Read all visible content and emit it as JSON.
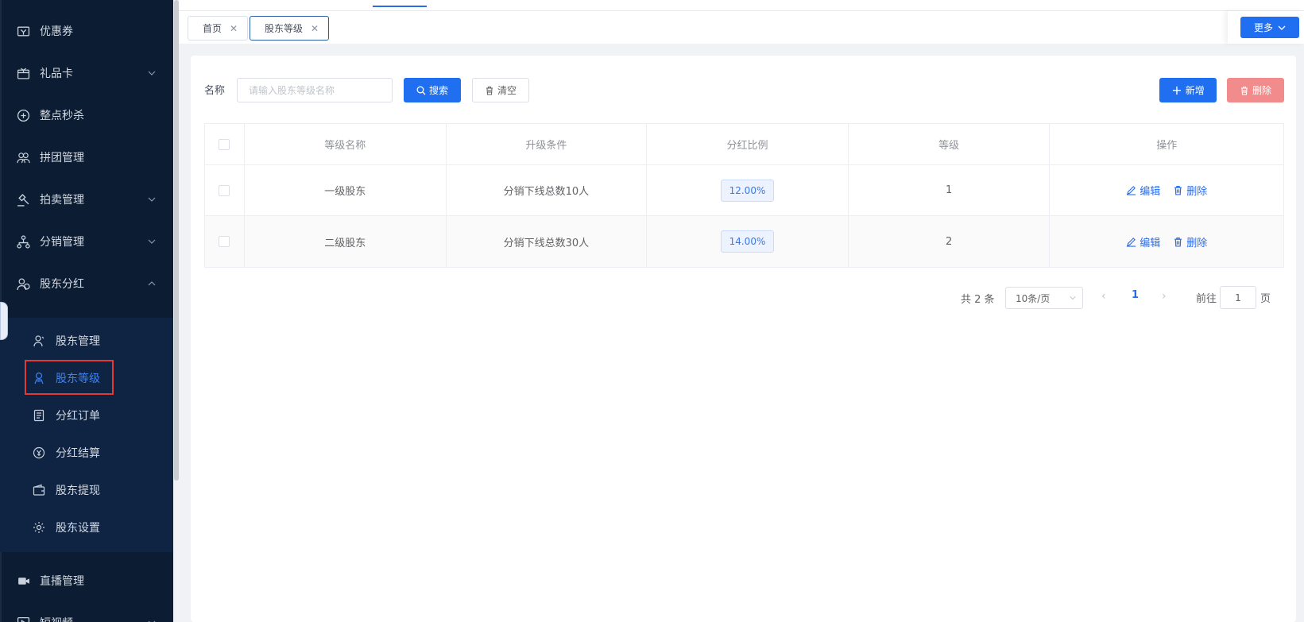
{
  "sidebar": {
    "items": [
      {
        "label": "优惠券",
        "icon": "coupon-icon"
      },
      {
        "label": "礼品卡",
        "icon": "gift-card-icon"
      },
      {
        "label": "整点秒杀",
        "icon": "flash-sale-icon"
      },
      {
        "label": "拼团管理",
        "icon": "group-buy-icon"
      },
      {
        "label": "拍卖管理",
        "icon": "auction-icon"
      },
      {
        "label": "分销管理",
        "icon": "distribution-icon"
      },
      {
        "label": "股东分红",
        "icon": "shareholder-dividend-icon"
      }
    ],
    "sub_items": [
      {
        "label": "股东管理",
        "icon": "user-icon"
      },
      {
        "label": "股东等级",
        "icon": "level-icon"
      },
      {
        "label": "分红订单",
        "icon": "order-icon"
      },
      {
        "label": "分红结算",
        "icon": "settlement-icon"
      },
      {
        "label": "股东提现",
        "icon": "wallet-icon"
      },
      {
        "label": "股东设置",
        "icon": "gear-icon"
      }
    ],
    "bottom_items": [
      {
        "label": "直播管理",
        "icon": "video-icon"
      },
      {
        "label": "短视频",
        "icon": "play-icon"
      }
    ]
  },
  "tabs": [
    {
      "label": "首页"
    },
    {
      "label": "股东等级"
    }
  ],
  "more_button": "更多",
  "filter": {
    "name_label": "名称",
    "placeholder": "请输入股东等级名称",
    "search_label": "搜索",
    "clear_label": "清空"
  },
  "actions": {
    "add_label": "新增",
    "delete_label": "删除"
  },
  "table": {
    "headers": [
      "等级名称",
      "升级条件",
      "分红比例",
      "等级",
      "操作"
    ],
    "rows": [
      {
        "name": "一级股东",
        "condition": "分销下线总数10人",
        "ratio": "12.00%",
        "level": "1"
      },
      {
        "name": "二级股东",
        "condition": "分销下线总数30人",
        "ratio": "14.00%",
        "level": "2"
      }
    ],
    "edit_label": "编辑",
    "row_delete_label": "删除"
  },
  "pagination": {
    "total": "共 2 条",
    "page_size": "10条/页",
    "current_page": "1",
    "goto_label": "前往",
    "goto_value": "1",
    "page_suffix": "页"
  },
  "colors": {
    "primary": "#1f6ff0",
    "danger_light": "#f28b8b",
    "sidebar_bg": "#0b1c33"
  }
}
